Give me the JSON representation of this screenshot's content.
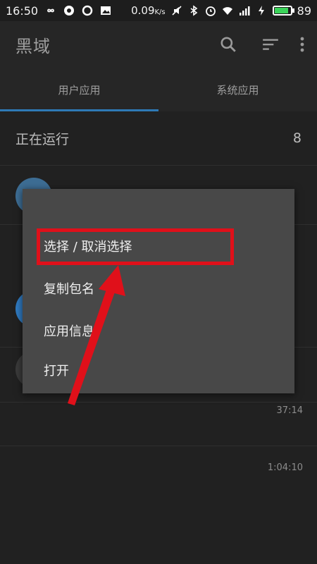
{
  "status_bar": {
    "time": "16:50",
    "network_speed": "0.09",
    "battery": "89",
    "battery_level": 0.89,
    "battery_color": "#3bd45a"
  },
  "toolbar": {
    "title": "黑域",
    "icons": [
      "search-icon",
      "sort-icon",
      "more-vert-icon"
    ]
  },
  "tabs": [
    {
      "label": "用户应用",
      "active": true
    },
    {
      "label": "系统应用",
      "active": false
    }
  ],
  "section": {
    "label": "正在运行",
    "count": "8"
  },
  "background_rows": [
    {
      "time": "37:14"
    },
    {
      "time": "1:04:10"
    }
  ],
  "context_menu": {
    "items": [
      {
        "label": "选择 / 取消选择",
        "highlighted": true
      },
      {
        "label": "复制包名"
      },
      {
        "label": "应用信息"
      },
      {
        "label": "打开"
      }
    ]
  },
  "colors": {
    "accent": "#2e7ab6",
    "highlight": "#e0101a",
    "arrow": "#e0101a"
  }
}
